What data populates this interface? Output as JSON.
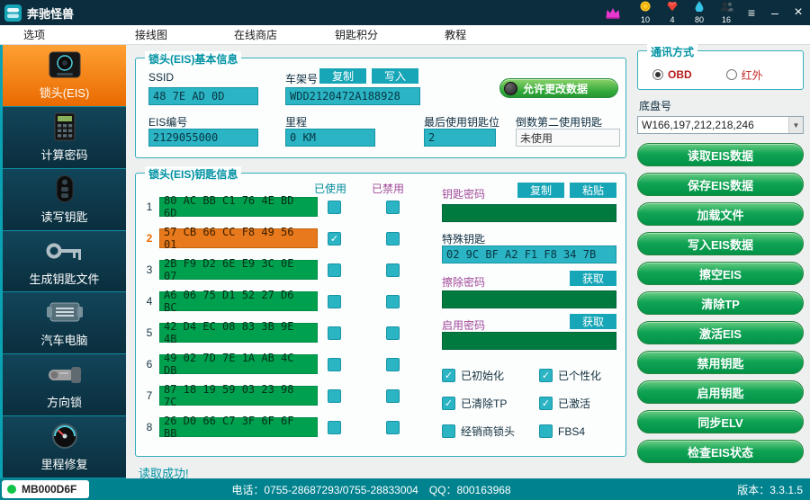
{
  "theme": {
    "titlebar_bg": "#0b2d3d",
    "accent_teal": "#2ab4c4",
    "key_green": "#00a14e",
    "selected_orange": "#e8791c",
    "action_button_green": "#009a4c",
    "statusbar_bg": "#00838f",
    "active_sidebar_orange": "#ef7d12"
  },
  "titlebar": {
    "title": "奔驰怪兽",
    "stats": [
      {
        "icon": "coin-icon",
        "value": "10"
      },
      {
        "icon": "gem-icon",
        "value": "4"
      },
      {
        "icon": "drop-icon",
        "value": "80"
      },
      {
        "icon": "users-icon",
        "value": "16"
      }
    ],
    "menu_glyph": "≡",
    "minimize_glyph": "–",
    "close_glyph": "×"
  },
  "menu": {
    "items": [
      "选项",
      "接线图",
      "在线商店",
      "钥匙积分",
      "教程"
    ]
  },
  "sidebar": {
    "items": [
      {
        "label": "锁头(EIS)",
        "icon": "eis-lock-icon",
        "active": true
      },
      {
        "label": "计算密码",
        "icon": "calculator-icon",
        "active": false
      },
      {
        "label": "读写钥匙",
        "icon": "key-fob-icon",
        "active": false
      },
      {
        "label": "生成钥匙文件",
        "icon": "key-file-icon",
        "active": false
      },
      {
        "label": "汽车电脑",
        "icon": "car-ecu-icon",
        "active": false
      },
      {
        "label": "方向锁",
        "icon": "steering-lock-icon",
        "active": false
      },
      {
        "label": "里程修复",
        "icon": "odometer-icon",
        "active": false
      }
    ]
  },
  "basic_info": {
    "title": "锁头(EIS)基本信息",
    "ssid_label": "SSID",
    "ssid_value": "48 7E AD 0D",
    "vin_label": "车架号",
    "copy_button": "复制",
    "write_button": "写入",
    "vin_value": "WDD2120472A188928",
    "allow_change_button": "允许更改数据",
    "eis_number_label": "EIS编号",
    "eis_number_value": "2129055000",
    "mileage_label": "里程",
    "mileage_value": "0 KM",
    "last_key_label": "最后使用钥匙位",
    "last_key_value": "2",
    "prev_key_label": "倒数第二使用钥匙",
    "prev_key_value": "未使用"
  },
  "key_info": {
    "title": "锁头(EIS)钥匙信息",
    "used_header": "已使用",
    "disabled_header": "已禁用",
    "rows": [
      {
        "num": "1",
        "hex": "80 AC BB C1 76 4E BD 6D",
        "used": false,
        "disabled": false,
        "selected": false
      },
      {
        "num": "2",
        "hex": "57 CB 66 CC F8 49 56 01",
        "used": true,
        "disabled": false,
        "selected": true
      },
      {
        "num": "3",
        "hex": "2B F9 D2 6E E9 3C 0E 07",
        "used": false,
        "disabled": false,
        "selected": false
      },
      {
        "num": "4",
        "hex": "A6 06 75 D1 52 27 D6 BC",
        "used": false,
        "disabled": false,
        "selected": false
      },
      {
        "num": "5",
        "hex": "42 D4 EC 08 83 3B 9E 4B",
        "used": false,
        "disabled": false,
        "selected": false
      },
      {
        "num": "6",
        "hex": "49 02 7D 7E 1A AB 4C DB",
        "used": false,
        "disabled": false,
        "selected": false
      },
      {
        "num": "7",
        "hex": "87 18 19 59 03 23 98 7C",
        "used": false,
        "disabled": false,
        "selected": false
      },
      {
        "num": "8",
        "hex": "26 D0 66 C7 3F 6F 6F BB",
        "used": false,
        "disabled": false,
        "selected": false
      }
    ],
    "key_password_label": "钥匙密码",
    "copy_button": "复制",
    "paste_button": "粘贴",
    "key_password_value": "",
    "special_key_label": "特殊钥匙",
    "special_key_value": "02 9C BF A2 F1 F8 34 7B",
    "erase_password_label": "擦除密码",
    "get_button": "获取",
    "erase_password_value": "",
    "enable_password_label": "启用密码",
    "enable_password_value": "",
    "flags": [
      {
        "label": "已初始化",
        "checked": true
      },
      {
        "label": "已个性化",
        "checked": true
      },
      {
        "label": "已清除TP",
        "checked": true
      },
      {
        "label": "已激活",
        "checked": true
      },
      {
        "label": "经销商锁头",
        "checked": false
      },
      {
        "label": "FBS4",
        "checked": false
      }
    ]
  },
  "status_message": "读取成功!",
  "right_panel": {
    "comm_title": "通讯方式",
    "comm_options": [
      {
        "label": "OBD",
        "selected": true
      },
      {
        "label": "红外",
        "selected": false
      }
    ],
    "chassis_label": "底盘号",
    "chassis_value": "W166,197,212,218,246",
    "buttons": [
      "读取EIS数据",
      "保存EIS数据",
      "加载文件",
      "写入EIS数据",
      "擦空EIS",
      "清除TP",
      "激活EIS",
      "禁用钥匙",
      "启用钥匙",
      "同步ELV",
      "检查EIS状态"
    ]
  },
  "statusbar": {
    "device_id": "MB000D6F",
    "contact": "电话：0755-28687293/0755-28833004　QQ：800163968",
    "version": "版本：3.3.1.5"
  }
}
